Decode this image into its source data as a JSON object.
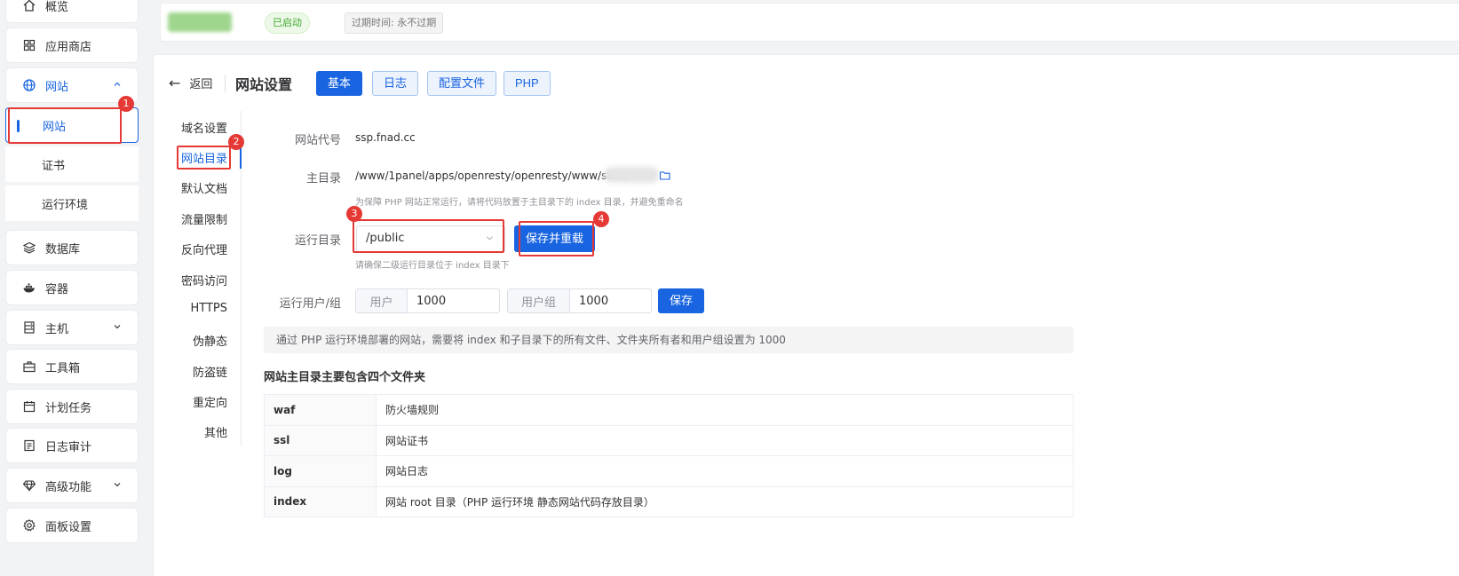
{
  "sidebar": {
    "items": [
      {
        "label": "概览",
        "icon": "home-icon"
      },
      {
        "label": "应用商店",
        "icon": "grid-icon"
      },
      {
        "label": "网站",
        "icon": "globe-icon"
      },
      {
        "label": "网站"
      },
      {
        "label": "证书"
      },
      {
        "label": "运行环境"
      },
      {
        "label": "数据库",
        "icon": "layers-icon"
      },
      {
        "label": "容器",
        "icon": "docker-icon"
      },
      {
        "label": "主机",
        "icon": "server-icon"
      },
      {
        "label": "工具箱",
        "icon": "toolbox-icon"
      },
      {
        "label": "计划任务",
        "icon": "calendar-icon"
      },
      {
        "label": "日志审计",
        "icon": "log-icon"
      },
      {
        "label": "高级功能",
        "icon": "diamond-icon"
      },
      {
        "label": "面板设置",
        "icon": "gear-icon"
      }
    ]
  },
  "topbar": {
    "status": "已启动",
    "expire": "过期时间: 永不过期"
  },
  "header": {
    "back": "返回",
    "title": "网站设置",
    "tabs": [
      "基本",
      "日志",
      "配置文件",
      "PHP"
    ]
  },
  "leftmenu": [
    "域名设置",
    "网站目录",
    "默认文档",
    "流量限制",
    "反向代理",
    "密码访问",
    "HTTPS",
    "伪静态",
    "防盗链",
    "重定向",
    "其他"
  ],
  "form": {
    "alias_label": "网站代号",
    "alias_value": "ssp.fnad.cc",
    "root_label": "主目录",
    "root_value": "/www/1panel/apps/openresty/openresty/www/sites/",
    "root_hint": "为保障 PHP 网站正常运行，请将代码放置于主目录下的 index 目录，并避免重命名",
    "run_label": "运行目录",
    "run_value": "/public",
    "run_button": "保存并重载",
    "run_hint": "请确保二级运行目录位于 index 目录下",
    "user_label": "运行用户/组",
    "user_prefix": "用户",
    "user_value": "1000",
    "group_prefix": "用户组",
    "group_value": "1000",
    "save_button": "保存"
  },
  "note": "通过 PHP 运行环境部署的网站，需要将 index 和子目录下的所有文件、文件夹所有者和用户组设置为 1000",
  "folders": {
    "title": "网站主目录主要包含四个文件夹",
    "rows": [
      {
        "name": "waf",
        "desc": "防火墙规则"
      },
      {
        "name": "ssl",
        "desc": "网站证书"
      },
      {
        "name": "log",
        "desc": "网站日志"
      },
      {
        "name": "index",
        "desc": "网站 root 目录（PHP 运行环境 静态网站代码存放目录）"
      }
    ]
  },
  "annotations": [
    "1",
    "2",
    "3",
    "4"
  ],
  "colors": {
    "accent": "#1964e1",
    "annotation": "#e53935",
    "success": "#3eaa2a"
  }
}
